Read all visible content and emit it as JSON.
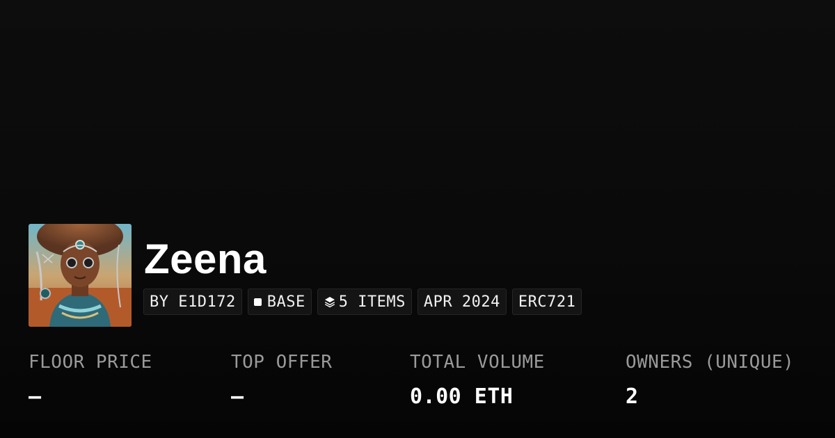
{
  "collection": {
    "title": "Zeena",
    "avatar_icon": "portrait-artwork",
    "tags": {
      "creator": "BY E1D172",
      "chain": "BASE",
      "items": "5 ITEMS",
      "date": "APR 2024",
      "standard": "ERC721"
    }
  },
  "stats": [
    {
      "label": "FLOOR PRICE",
      "value": "–"
    },
    {
      "label": "TOP OFFER",
      "value": "–"
    },
    {
      "label": "TOTAL VOLUME",
      "value": "0.00 ETH"
    },
    {
      "label": "OWNERS (UNIQUE)",
      "value": "2"
    }
  ],
  "colors": {
    "background": "#0b0b0b",
    "tag_background": "#141414",
    "tag_border": "#262626",
    "label": "#9a9a9a",
    "value": "#ffffff"
  }
}
